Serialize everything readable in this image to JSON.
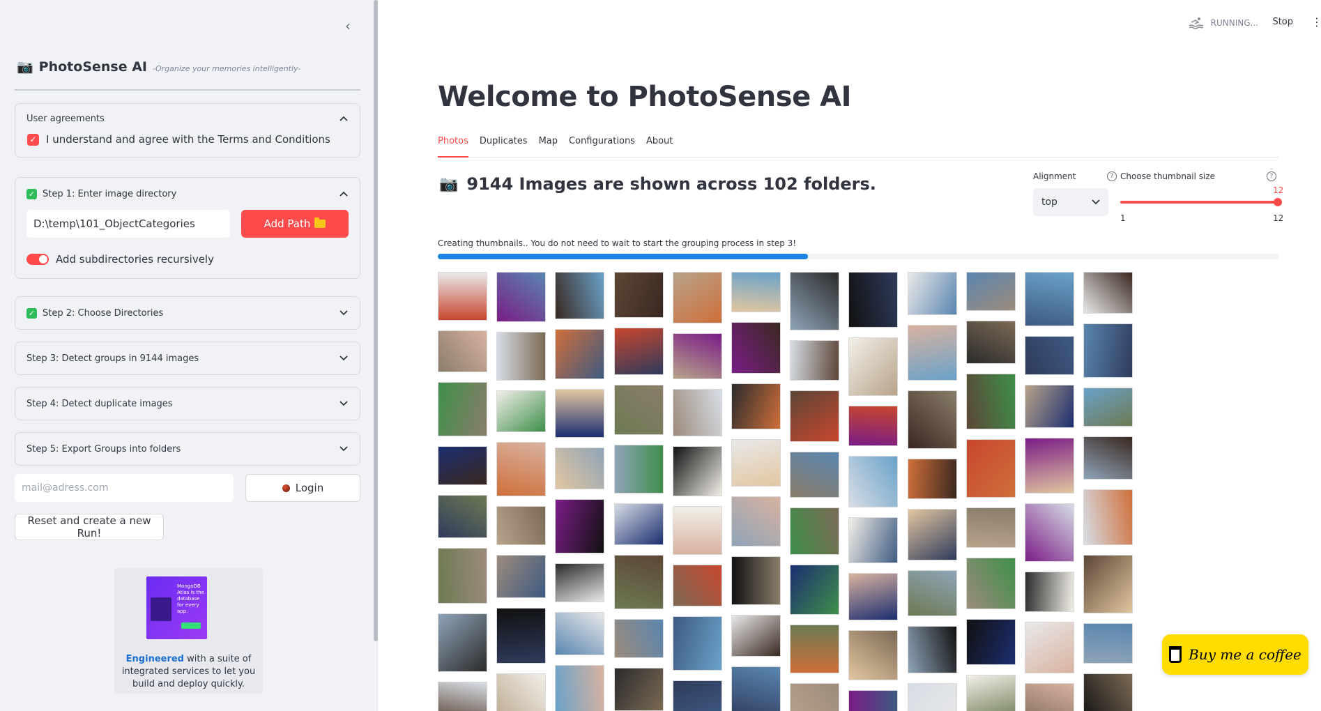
{
  "sidebar": {
    "collapse_icon": "‹",
    "brand": {
      "icon": "📷",
      "title": "PhotoSense AI",
      "subtitle": "-Organize your memories intelligently-"
    },
    "agreements": {
      "title": "User agreements",
      "checkbox_label": "I understand and agree with the Terms and Conditions",
      "checked": true
    },
    "step1": {
      "title": "Step 1: Enter image directory",
      "path_value": "D:\\temp\\101_ObjectCategories",
      "add_button_label": "Add Path",
      "toggle_label": "Add subdirectories recursively",
      "toggle_on": true
    },
    "step2": {
      "title": "Step 2: Choose Directories"
    },
    "step3": {
      "title": "Step 3: Detect groups in 9144 images"
    },
    "step4": {
      "title": "Step 4: Detect duplicate images"
    },
    "step5": {
      "title": "Step 5: Export Groups into folders"
    },
    "email_placeholder": "mail@adress.com",
    "login_label": "Login",
    "reset_label": "Reset and create a new Run!",
    "ad": {
      "image_text": "MongoDB Atlas is the database for every app.",
      "text_bold": "Engineered",
      "text_rest": " with a suite of integrated services to let you build and deploy quickly."
    }
  },
  "header": {
    "status": "RUNNING...",
    "stop_label": "Stop",
    "menu_icon": "⋮"
  },
  "main": {
    "title": "Welcome to PhotoSense AI",
    "tabs": [
      {
        "label": "Photos",
        "active": true
      },
      {
        "label": "Duplicates",
        "active": false
      },
      {
        "label": "Map",
        "active": false
      },
      {
        "label": "Configurations",
        "active": false
      },
      {
        "label": "About",
        "active": false
      }
    ],
    "summary_icon": "📷",
    "summary": "9144 Images are shown across 102 folders.",
    "alignment": {
      "label": "Alignment",
      "value": "top"
    },
    "thumbnail_size": {
      "label": "Choose thumbnail size",
      "value": "12",
      "min": "1",
      "max": "12"
    },
    "progress": {
      "label": "Creating thumbnails.. You do not need to wait to start the grouping process in step 3!",
      "fraction": 0.44
    },
    "thumbnail_count": 96
  },
  "coffee": {
    "label": "Buy me a coffee"
  },
  "colors": {
    "accent": "#ff4b4b",
    "progress": "#1c83e1",
    "success": "#2ebd59",
    "coffee": "#ffdd00"
  }
}
